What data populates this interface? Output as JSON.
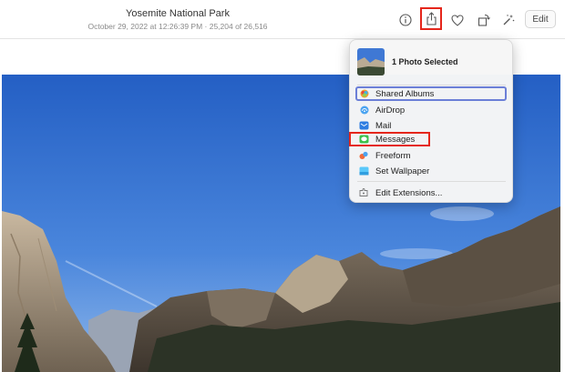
{
  "header": {
    "title": "Yosemite National Park",
    "subtitle": "October 29, 2022 at 12:26:39 PM  ·  25,204 of 26,516"
  },
  "toolbar": {
    "icons": [
      "info-icon",
      "share-icon",
      "heart-icon",
      "rotate-icon",
      "magic-wand-icon"
    ],
    "edit_label": "Edit"
  },
  "share_menu": {
    "header_label": "1 Photo Selected",
    "items": [
      {
        "label": "Shared Albums",
        "icon": "shared-albums-icon",
        "color": "#f0a030"
      },
      {
        "label": "AirDrop",
        "icon": "airdrop-icon",
        "color": "#4aa3f0"
      },
      {
        "label": "Mail",
        "icon": "mail-icon",
        "color": "#2f7de1"
      },
      {
        "label": "Messages",
        "icon": "messages-icon",
        "color": "#3cc14b"
      },
      {
        "label": "Freeform",
        "icon": "freeform-icon",
        "color": "#f06a3a"
      },
      {
        "label": "Set Wallpaper",
        "icon": "wallpaper-icon",
        "color": "#5ac8fa"
      }
    ],
    "extensions_label": "Edit Extensions..."
  },
  "colors": {
    "highlight_red": "#e5261b",
    "highlight_blue": "#6b7fd7",
    "sky": "#2f6fd0"
  }
}
